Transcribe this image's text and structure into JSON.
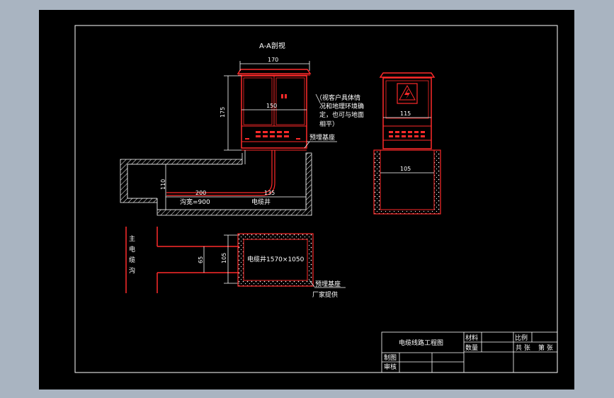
{
  "colors": {
    "background": "#a9b4c1",
    "sheet": "#000000",
    "frame": "#ffffff",
    "cabinet": "#ff2a2a",
    "dims": "#ffffff"
  },
  "section": {
    "title": "A-A剖视",
    "dim_170": "170",
    "dim_150": "150",
    "dim_175": "175",
    "dim_110": "110",
    "dim_200": "200",
    "dim_135": "135",
    "trench_width": "沟宽=900",
    "cable_well": "电缆井",
    "embedded_base": "预埋基座",
    "note_lines": [
      "（视客户具体情",
      "况和地理环境确",
      "定，也可与地面",
      "相平）"
    ]
  },
  "front": {
    "dim_115": "115",
    "dim_105": "105"
  },
  "plan": {
    "main_trench": "主电缆沟",
    "dim_65": "65",
    "dim_105": "105",
    "well_label": "电缆井1570×1050",
    "embedded_base": "预埋基座",
    "supplied_by": "厂家提供"
  },
  "title_block": {
    "drawing_title": "电缆线路工程图",
    "material": "材料",
    "quantity": "数量",
    "scale": "比例",
    "total": "共 张",
    "sheet_no": "第 张",
    "drawn": "制图",
    "checked": "审核"
  }
}
